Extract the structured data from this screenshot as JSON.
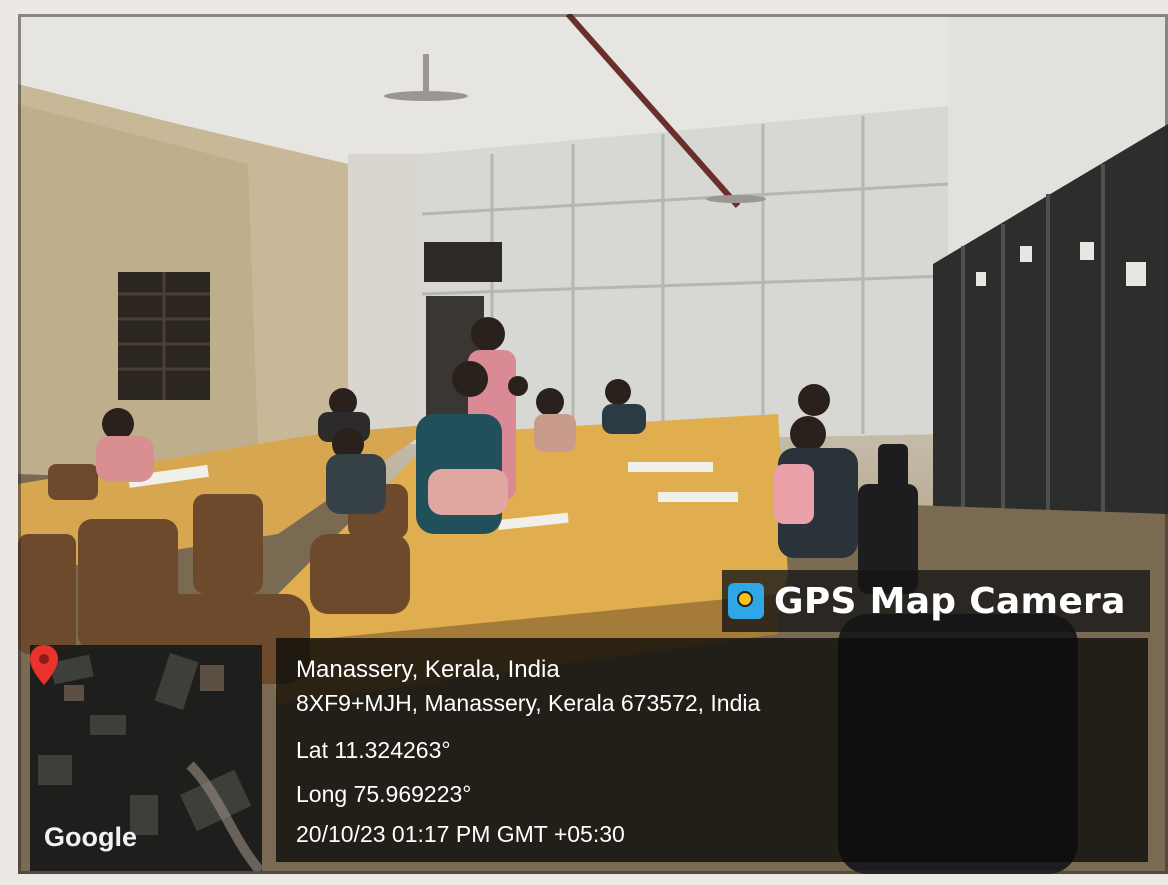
{
  "overlay": {
    "app_name": "GPS Map Camera",
    "app_icon": "gps-map-camera-icon",
    "map_label": "Google",
    "map_pin_icon": "location-pin-icon",
    "location_title": "Manassery, Kerala, India",
    "address": "8XF9+MJH, Manassery, Kerala 673572, India",
    "latitude": "Lat 11.324263°",
    "longitude": "Long 75.969223°",
    "timestamp": "20/10/23 01:17 PM GMT +05:30"
  }
}
